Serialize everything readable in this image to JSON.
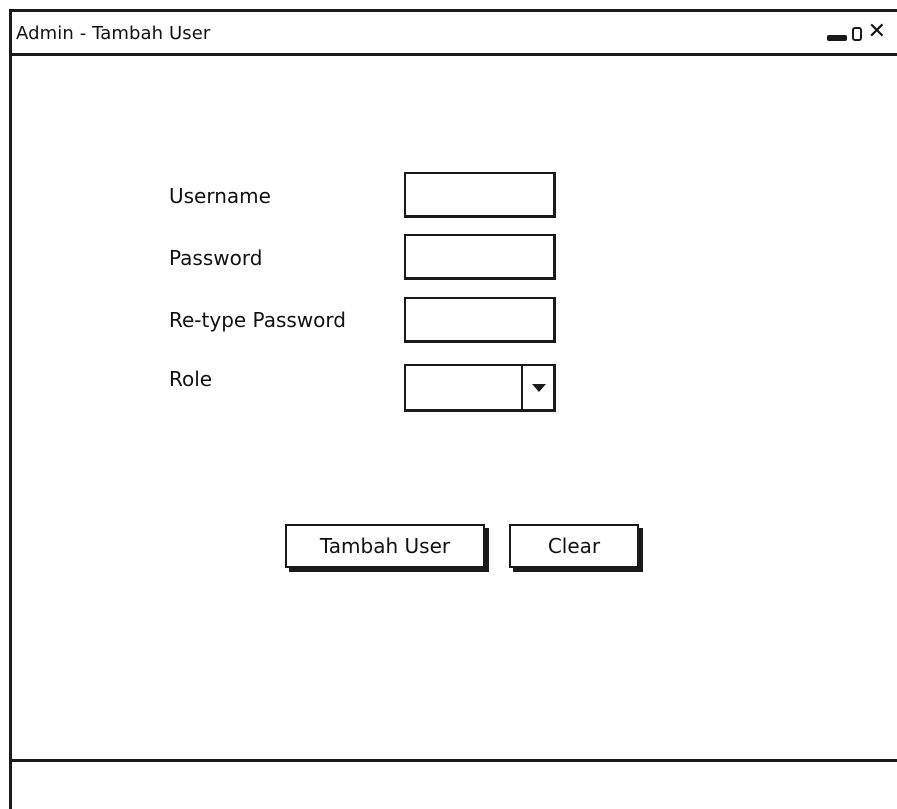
{
  "window": {
    "title": "Admin - Tambah User",
    "controls": {
      "minimize_icon": "minimize-icon",
      "maximize_icon": "maximize-icon",
      "close_icon": "close-icon",
      "close_glyph": "✕"
    }
  },
  "form": {
    "username_label": "Username",
    "password_label": "Password",
    "retype_password_label": "Re-type Password",
    "role_label": "Role",
    "username_value": "",
    "password_value": "",
    "retype_password_value": "",
    "role_selected": ""
  },
  "buttons": {
    "submit_label": "Tambah User",
    "clear_label": "Clear"
  },
  "colors": {
    "ink": "#1a1a1a",
    "background": "#ffffff"
  }
}
